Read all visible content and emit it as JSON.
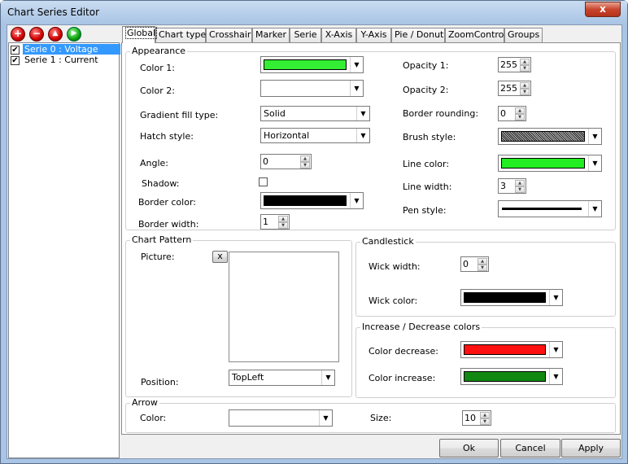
{
  "window": {
    "title": "Chart Series Editor",
    "close_glyph": "x"
  },
  "toolbar": {
    "buttons": [
      {
        "name": "add",
        "glyph": "+",
        "color": "red"
      },
      {
        "name": "remove",
        "glyph": "−",
        "color": "red"
      },
      {
        "name": "move-up",
        "glyph": "▲",
        "color": "red"
      },
      {
        "name": "move-down",
        "glyph": "▶",
        "color": "green"
      }
    ]
  },
  "series_list": [
    {
      "label": "Serie 0 : Voltage",
      "checked": true,
      "selected": true
    },
    {
      "label": "Serie 1 : Current",
      "checked": true,
      "selected": false
    }
  ],
  "tabs": [
    "Global",
    "Chart type",
    "Crosshair",
    "Marker",
    "Serie",
    "X-Axis",
    "Y-Axis",
    "Pie / Donut",
    "ZoomControl",
    "Groups"
  ],
  "active_tab": "Global",
  "appearance": {
    "title": "Appearance",
    "color1_label": "Color 1:",
    "color1_value": "#33ee33",
    "color2_label": "Color 2:",
    "color2_value": "#ffffff",
    "gradient_label": "Gradient fill type:",
    "gradient_value": "Solid",
    "hatch_label": "Hatch style:",
    "hatch_value": "Horizontal",
    "angle_label": "Angle:",
    "angle_value": "0",
    "shadow_label": "Shadow:",
    "bordercolor_label": "Border color:",
    "bordercolor_value": "#000000",
    "borderwidth_label": "Border width:",
    "borderwidth_value": "1",
    "opacity1_label": "Opacity 1:",
    "opacity1_value": "255",
    "opacity2_label": "Opacity 2:",
    "opacity2_value": "255",
    "rounding_label": "Border rounding:",
    "rounding_value": "0",
    "brush_label": "Brush style:",
    "linecolor_label": "Line color:",
    "linecolor_value": "#22ee22",
    "linewidth_label": "Line width:",
    "linewidth_value": "3",
    "penstyle_label": "Pen style:"
  },
  "pattern": {
    "title": "Chart Pattern",
    "picture_label": "Picture:",
    "clear_glyph": "x",
    "position_label": "Position:",
    "position_value": "TopLeft"
  },
  "candlestick": {
    "title": "Candlestick",
    "wickwidth_label": "Wick width:",
    "wickwidth_value": "0",
    "wickcolor_label": "Wick color:",
    "wickcolor_value": "#000000"
  },
  "incdec": {
    "title": "Increase / Decrease colors",
    "decrease_label": "Color decrease:",
    "decrease_value": "#ff1111",
    "increase_label": "Color increase:",
    "increase_value": "#118811"
  },
  "arrow": {
    "title": "Arrow",
    "color_label": "Color:",
    "size_label": "Size:",
    "size_value": "10"
  },
  "buttons": {
    "ok": "Ok",
    "cancel": "Cancel",
    "apply": "Apply"
  }
}
